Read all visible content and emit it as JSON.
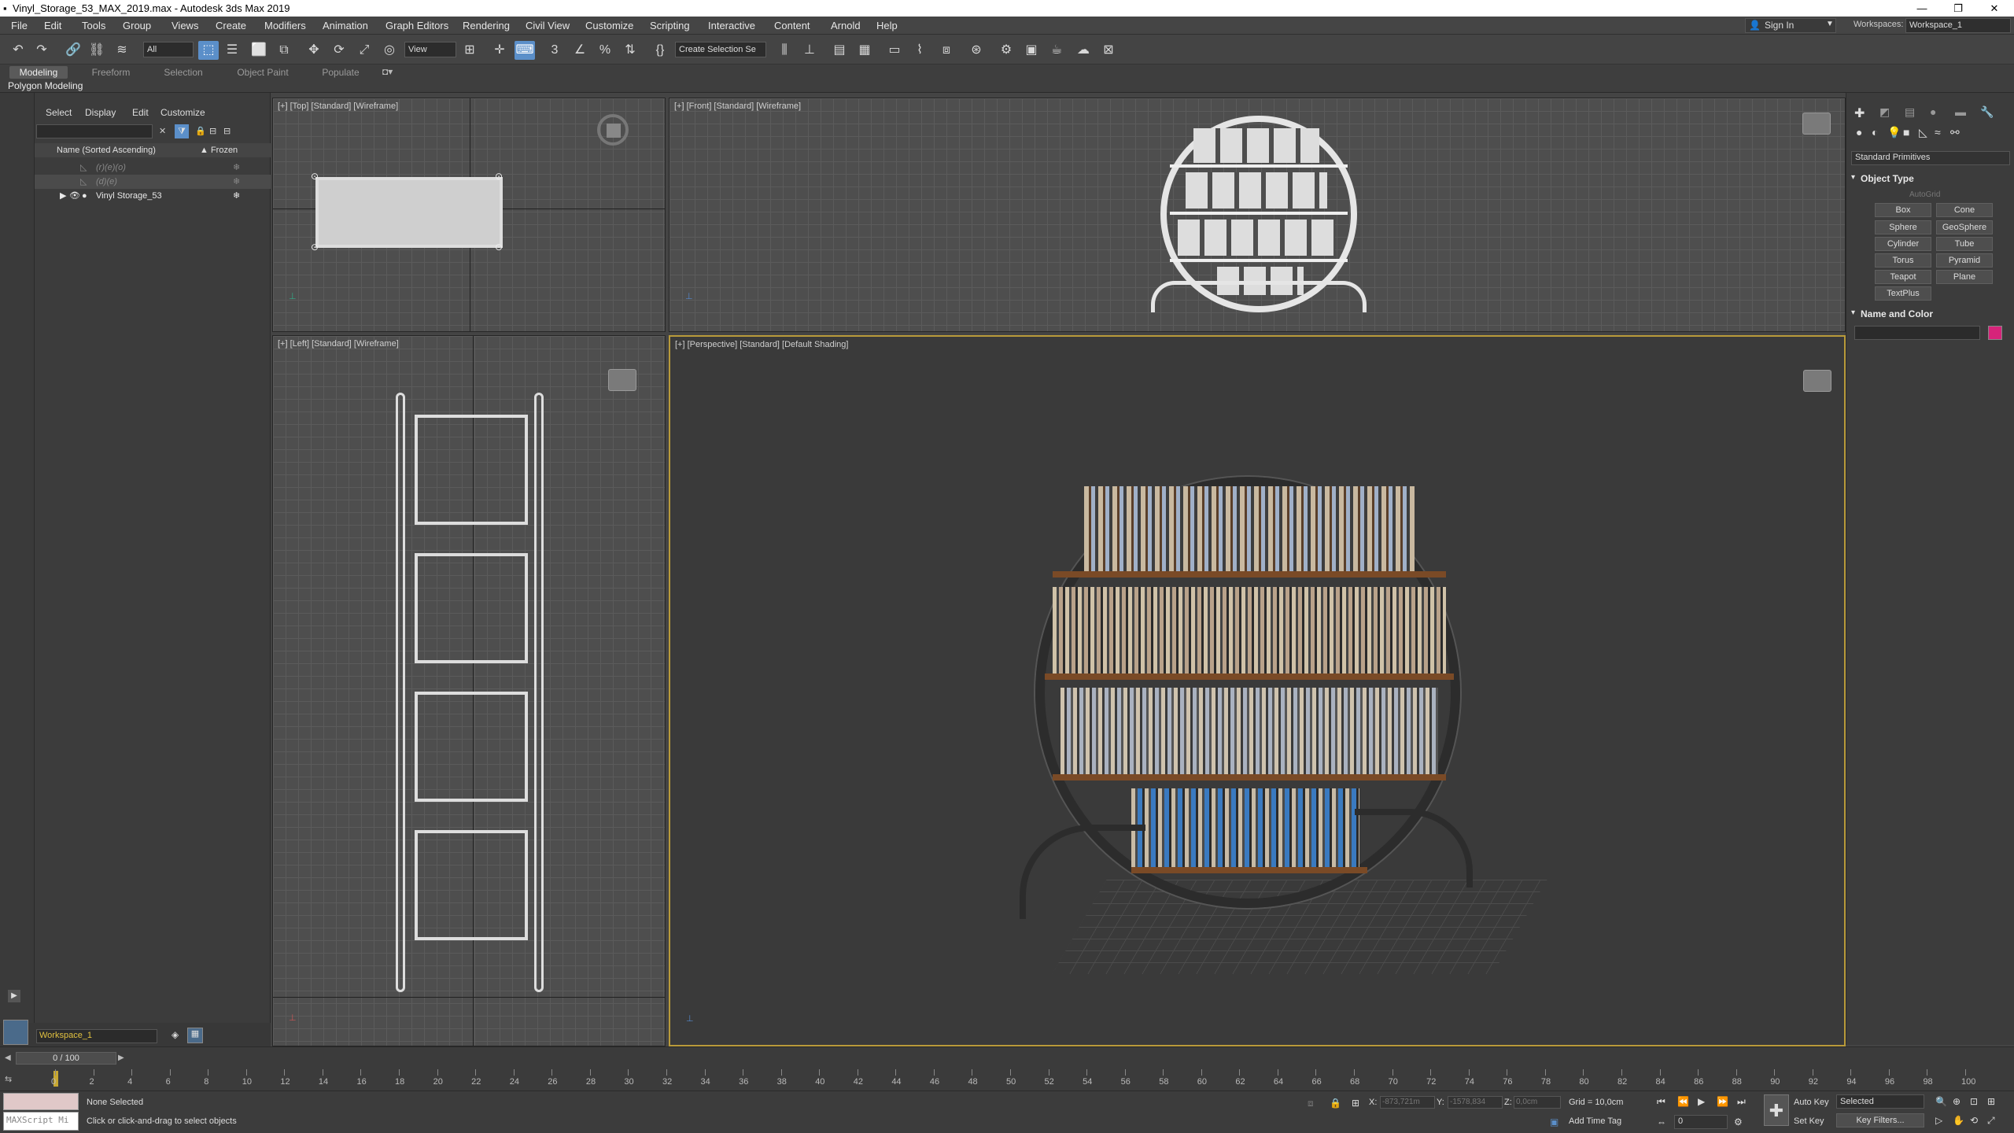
{
  "title": "Vinyl_Storage_53_MAX_2019.max - Autodesk 3ds Max 2019",
  "menu": [
    "File",
    "Edit",
    "Tools",
    "Group",
    "Views",
    "Create",
    "Modifiers",
    "Animation",
    "Graph Editors",
    "Rendering",
    "Civil View",
    "Customize",
    "Scripting",
    "Interactive",
    "Content",
    "Arnold",
    "Help"
  ],
  "signin": "Sign In",
  "workspaces_label": "Workspaces:",
  "workspace": "Workspace_1",
  "toolbar": {
    "filter": "All",
    "refcoord": "View",
    "selset": "Create Selection Se"
  },
  "ribbon": {
    "tabs": [
      "Modeling",
      "Freeform",
      "Selection",
      "Object Paint",
      "Populate"
    ],
    "sub": "Polygon Modeling"
  },
  "scene": {
    "tabs": [
      "Select",
      "Display",
      "Edit",
      "Customize"
    ],
    "col_name": "Name (Sorted Ascending)",
    "col_frozen": "▲ Frozen",
    "items": [
      "(r)(e)(o)",
      "(d)(e)",
      "Vinyl Storage_53"
    ]
  },
  "workspace_field": "Workspace_1",
  "viewports": {
    "top": "[+] [Top] [Standard] [Wireframe]",
    "front": "[+] [Front] [Standard] [Wireframe]",
    "left": "[+] [Left] [Standard] [Wireframe]",
    "persp": "[+] [Perspective] [Standard] [Default Shading]"
  },
  "cmd": {
    "dropdown": "Standard Primitives",
    "object_type": "Object Type",
    "autogrid": "AutoGrid",
    "buttons": [
      "Box",
      "Cone",
      "Sphere",
      "GeoSphere",
      "Cylinder",
      "Tube",
      "Torus",
      "Pyramid",
      "Teapot",
      "Plane",
      "TextPlus"
    ],
    "name_color": "Name and Color",
    "swatch": "#d6247a"
  },
  "timeline": {
    "frame": "0 / 100",
    "ticks": [
      "0",
      "2",
      "4",
      "6",
      "8",
      "10",
      "12",
      "14",
      "16",
      "18",
      "20",
      "22",
      "24",
      "26",
      "28",
      "30",
      "32",
      "34",
      "36",
      "38",
      "40",
      "42",
      "44",
      "46",
      "48",
      "50",
      "52",
      "54",
      "56",
      "58",
      "60",
      "62",
      "64",
      "66",
      "68",
      "70",
      "72",
      "74",
      "76",
      "78",
      "80",
      "82",
      "84",
      "86",
      "88",
      "90",
      "92",
      "94",
      "96",
      "98",
      "100"
    ]
  },
  "status": {
    "maxscript": "MAXScript Mi",
    "selected": "None Selected",
    "prompt": "Click or click-and-drag to select objects",
    "x_label": "X:",
    "x": "-873,721m",
    "y_label": "Y:",
    "y": "-1578,834",
    "z_label": "Z:",
    "z": "0,0cm",
    "grid": "Grid = 10,0cm",
    "addtime": "Add Time Tag",
    "autokey": "Auto Key",
    "setkey": "Set Key",
    "selected_dd": "Selected",
    "keyfilters": "Key Filters...",
    "frame_spin": "0"
  }
}
